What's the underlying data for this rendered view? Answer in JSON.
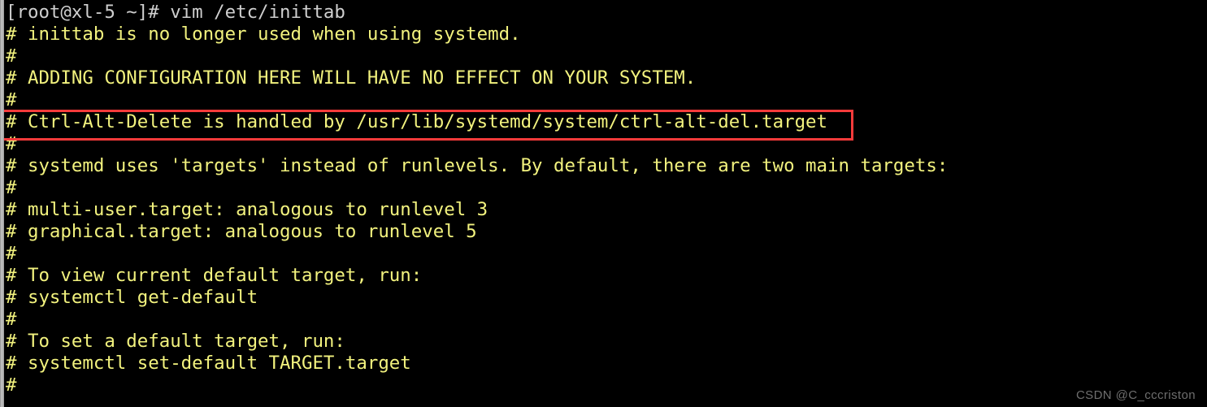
{
  "terminal": {
    "title": "vim /etc/inittab",
    "background_color": "#000000",
    "comment_color": "#f2f27e",
    "prompt_color": "#cfcfcf",
    "highlight_color": "#f73b3b",
    "watermark_color": "#6e6e6e",
    "prompt_line": "[root@xl-5 ~]# vim /etc/inittab",
    "lines": [
      "[root@xl-5 ~]# vim /etc/inittab",
      "# inittab is no longer used when using systemd.",
      "#",
      "# ADDING CONFIGURATION HERE WILL HAVE NO EFFECT ON YOUR SYSTEM.",
      "#",
      "# Ctrl-Alt-Delete is handled by /usr/lib/systemd/system/ctrl-alt-del.target",
      "#",
      "# systemd uses 'targets' instead of runlevels. By default, there are two main targets:",
      "#",
      "# multi-user.target: analogous to runlevel 3",
      "# graphical.target: analogous to runlevel 5",
      "#",
      "# To view current default target, run:",
      "# systemctl get-default",
      "#",
      "# To set a default target, run:",
      "# systemctl set-default TARGET.target",
      "#"
    ]
  },
  "annotation": {
    "highlighted_line_index": 5,
    "highlighted_text": "# Ctrl-Alt-Delete is handled by /usr/lib/systemd/system/ctrl-alt-del.target",
    "shape": "rectangle",
    "color": "#f73b3b"
  },
  "watermark": {
    "text": "CSDN @C_cccriston"
  }
}
